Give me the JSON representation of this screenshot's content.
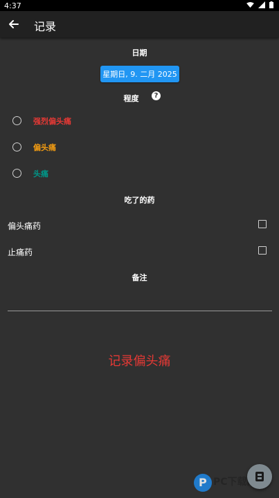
{
  "status_bar": {
    "time": "4:37"
  },
  "app_bar": {
    "title": "记录"
  },
  "date_section": {
    "label": "日期",
    "value": "星期日, 9. 二月 2025"
  },
  "severity": {
    "label": "程度",
    "help": "?",
    "options": [
      {
        "label": "强烈偏头痛",
        "color": "#e53935"
      },
      {
        "label": "偏头痛",
        "color": "#f39c12"
      },
      {
        "label": "头痛",
        "color": "#009688"
      }
    ]
  },
  "medication": {
    "label": "吃了的药",
    "items": [
      {
        "label": "偏头痛药"
      },
      {
        "label": "止痛药"
      }
    ]
  },
  "notes": {
    "label": "备注",
    "value": ""
  },
  "record_button": {
    "label": "记录偏头痛"
  },
  "watermark": {
    "text": "PC下载网"
  }
}
